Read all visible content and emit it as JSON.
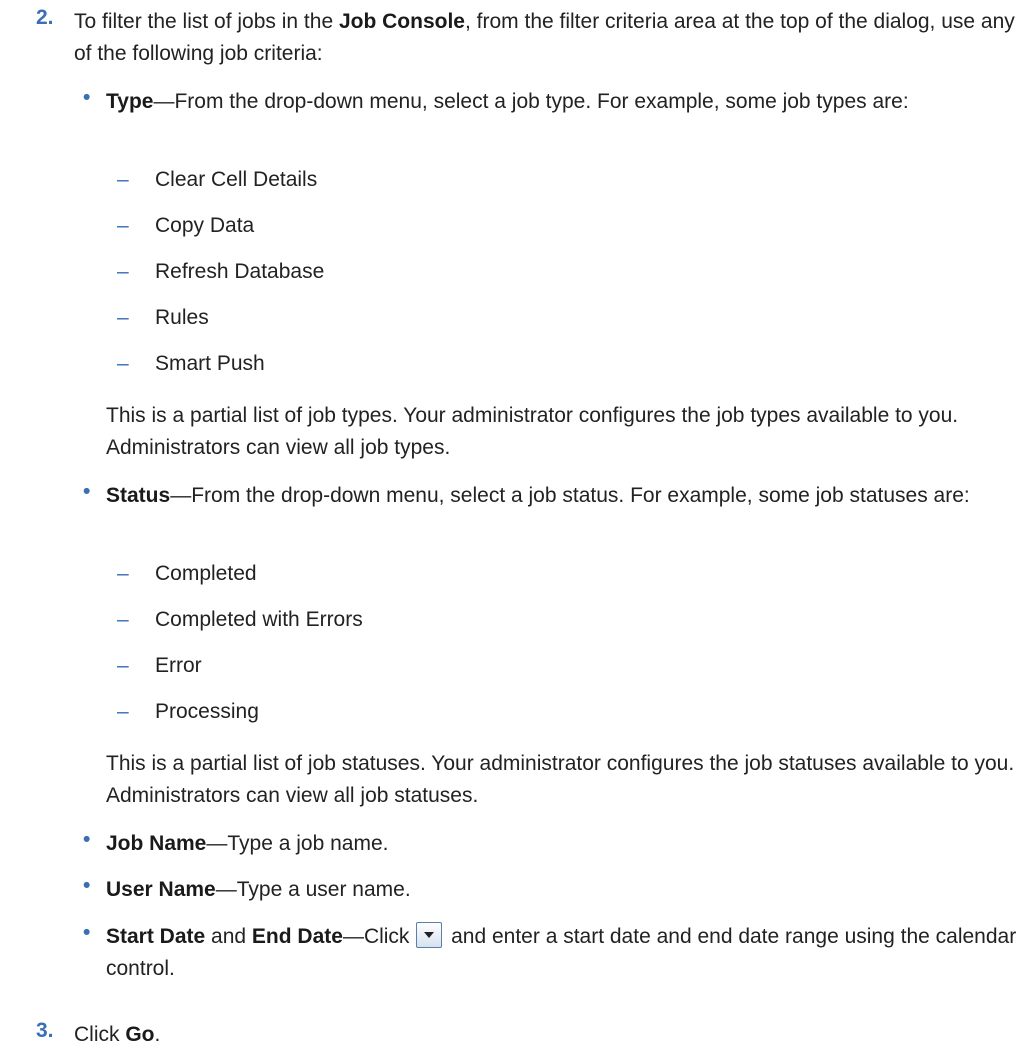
{
  "step2": {
    "number": "2.",
    "text_a": "To filter the list of jobs in the ",
    "bold_a": "Job Console",
    "text_b": ", from the filter criteria area at the top of the dialog, use any of the following job criteria:"
  },
  "type_item": {
    "label": "Type",
    "text": "—From the drop-down menu, select a job type. For example, some job types are:",
    "options": [
      "Clear Cell Details",
      "Copy Data",
      "Refresh Database",
      "Rules",
      "Smart Push"
    ],
    "note": "This is a partial list of job types. Your administrator configures the job types available to you. Administrators can view all job types."
  },
  "status_item": {
    "label": "Status",
    "text": "—From the drop-down menu, select a job status. For example, some job statuses are:",
    "options": [
      "Completed",
      "Completed with Errors",
      "Error",
      "Processing"
    ],
    "note": "This is a partial list of job statuses. Your administrator configures the job statuses available to you. Administrators can view all job statuses."
  },
  "job_name_item": {
    "label": "Job Name",
    "text": "—Type a job name."
  },
  "user_name_item": {
    "label": "User Name",
    "text": "—Type a user name."
  },
  "date_item": {
    "label_start": "Start Date",
    "text_and": " and ",
    "label_end": "End Date",
    "text_click": "—Click ",
    "icon": "dropdown-arrow-icon",
    "text_rest": " and enter a start date and end date range using the calendar control."
  },
  "step3": {
    "number": "3.",
    "text_a": "Click ",
    "bold_a": "Go",
    "text_b": "."
  },
  "markers": {
    "bullet": "•",
    "dash": "–"
  },
  "colors": {
    "accent": "#3a6fb5",
    "text": "#222222"
  }
}
